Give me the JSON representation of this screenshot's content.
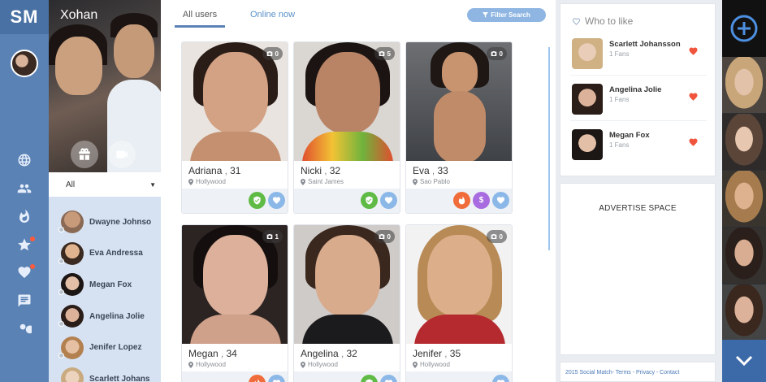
{
  "nav": {
    "logo": "SM",
    "icons": [
      {
        "name": "globe-icon",
        "badge": false
      },
      {
        "name": "users-icon",
        "badge": false
      },
      {
        "name": "flame-icon",
        "badge": false
      },
      {
        "name": "star-icon",
        "badge": true
      },
      {
        "name": "heart-icon",
        "badge": true
      },
      {
        "name": "chat-icon",
        "badge": false
      },
      {
        "name": "search-icon",
        "badge": false
      }
    ]
  },
  "profile": {
    "name": "Xohan",
    "filter": {
      "selected": "All"
    },
    "contacts": [
      {
        "name": "Dwayne Johnso"
      },
      {
        "name": "Eva Andressa"
      },
      {
        "name": "Megan Fox"
      },
      {
        "name": "Angelina Jolie"
      },
      {
        "name": "Jenifer Lopez"
      },
      {
        "name": "Scarlett Johans"
      }
    ]
  },
  "main": {
    "tabs": {
      "all": "All users",
      "online": "Online now"
    },
    "filter_button": "Filter Search",
    "cards": [
      {
        "name": "Adriana",
        "age": "31",
        "location": "Hollywood",
        "photos": "0",
        "badges": [
          "verified",
          "like"
        ]
      },
      {
        "name": "Nicki",
        "age": "32",
        "location": "Saint James",
        "photos": "5",
        "badges": [
          "verified",
          "like"
        ]
      },
      {
        "name": "Eva",
        "age": "33",
        "location": "Sao Pablo",
        "photos": "0",
        "badges": [
          "hot",
          "dollar",
          "like"
        ]
      },
      {
        "name": "Megan",
        "age": "34",
        "location": "Hollywood",
        "photos": "1",
        "badges": [
          "hot",
          "like"
        ]
      },
      {
        "name": "Angelina",
        "age": "32",
        "location": "Hollywood",
        "photos": "0",
        "badges": [
          "verified",
          "like"
        ]
      },
      {
        "name": "Jenifer",
        "age": "35",
        "location": "Hollywood",
        "photos": "0",
        "badges": [
          "like"
        ]
      }
    ]
  },
  "who_to_like": {
    "title": "Who to like",
    "items": [
      {
        "name": "Scarlett Johansson",
        "fans": "1 Fans"
      },
      {
        "name": "Angelina Jolie",
        "fans": "1 Fans"
      },
      {
        "name": "Megan Fox",
        "fans": "1 Fans"
      }
    ]
  },
  "advertise": {
    "text": "ADVERTISE SPACE"
  },
  "footer": {
    "text": "2015 Social Match- Terms - Privacy - Contact"
  },
  "colors": {
    "accent": "#5a82b5",
    "heart": "#f0543c",
    "verified": "#5fbb46",
    "like": "#8cb8e8"
  }
}
